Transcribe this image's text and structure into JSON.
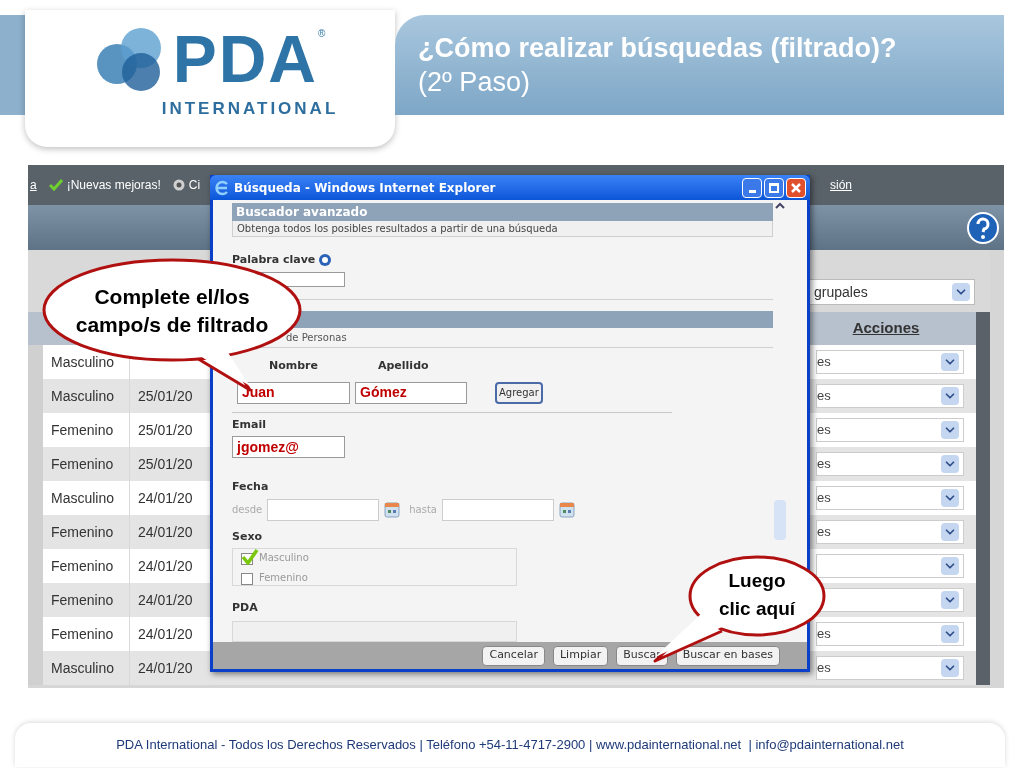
{
  "logo": {
    "name": "PDA",
    "mark": "®",
    "subtitle": "INTERNATIONAL"
  },
  "title": {
    "heading": "¿Cómo realizar búsquedas (filtrado)?",
    "step": "(2º Paso)"
  },
  "app": {
    "top_links": [
      {
        "label": "a",
        "kind": "link"
      },
      {
        "label": "¡Nuevas mejoras!",
        "kind": "check"
      },
      {
        "label": "Ci",
        "kind": "gear"
      }
    ],
    "session_link": "sión",
    "filter_select": "grupales",
    "actions_header": "Acciones",
    "rows": [
      {
        "gender": "Masculino",
        "action": "es"
      },
      {
        "gender": "Masculino",
        "date": "25/01/20",
        "action": "es"
      },
      {
        "gender": "Femenino",
        "date": "25/01/20",
        "action": "es"
      },
      {
        "gender": "Femenino",
        "date": "25/01/20",
        "action": "es"
      },
      {
        "gender": "Masculino",
        "date": "24/01/20",
        "action": "es"
      },
      {
        "gender": "Femenino",
        "date": "24/01/20",
        "action": "es"
      },
      {
        "gender": "Femenino",
        "date": "24/01/20"
      },
      {
        "gender": "Femenino",
        "date": "24/01/20"
      },
      {
        "gender": "Femenino",
        "date": "24/01/20",
        "action": "es"
      },
      {
        "gender": "Masculino",
        "date": "24/01/20",
        "action": "es"
      }
    ]
  },
  "dialog": {
    "title": "Búsqueda - Windows Internet Explorer",
    "section": "Buscador avanzado",
    "description": "Obtenga todos los posibles resultados a partir de una búsqueda",
    "keyword_label": "Palabra clave",
    "group_label": "de Personas",
    "name_label": "Nombre",
    "surname_label": "Apellido",
    "name_value": "Juan",
    "surname_value": "Gómez",
    "add_button": "Agregar",
    "email_label": "Email",
    "email_value": "jgomez@",
    "date_label": "Fecha",
    "from_label": "desde",
    "to_label": "hasta",
    "sex_label": "Sexo",
    "sex_options": [
      {
        "label": "Masculino",
        "checked": true
      },
      {
        "label": "Femenino",
        "checked": false
      }
    ],
    "pda_label": "PDA",
    "buttons": [
      "Cancelar",
      "Limpiar",
      "Buscar",
      "Buscar en bases"
    ]
  },
  "callouts": [
    {
      "text": "Complete el/los campo/s de filtrado"
    },
    {
      "text": "Luego clic aquí"
    }
  ],
  "footer": "PDA International - Todos los Derechos Reservados | Teléfono +54-11-4717-2900 | www.pdainternational.net  | info@pdainternational.net"
}
